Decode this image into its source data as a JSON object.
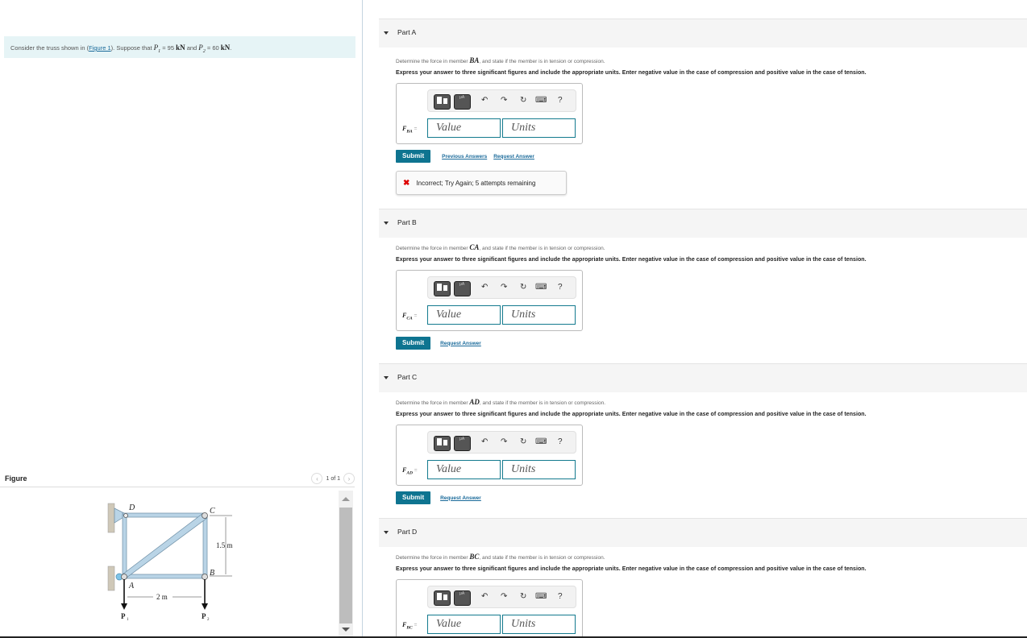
{
  "intro": {
    "prefix": "Consider the truss shown in (",
    "figure_link": "Figure 1",
    "mid": "). Suppose that ",
    "p1_sym": "P",
    "p1_sub": "1",
    "p1_eq": " = 95 ",
    "p1_unit": "kN",
    "and": " and ",
    "p2_sym": "P",
    "p2_sub": "2",
    "p2_eq": " = 60 ",
    "p2_unit": "kN",
    "end": "."
  },
  "figure": {
    "title": "Figure",
    "pager_text": "1 of 1",
    "labels": {
      "D": "D",
      "C": "C",
      "A": "A",
      "B": "B",
      "height": "1.5 m",
      "width": "2 m",
      "P1": "P",
      "P1_sub": "1",
      "P2": "P",
      "P2_sub": "2"
    },
    "colors": {
      "member": "#b9d4e6",
      "member_edge": "#6c8da4",
      "support": "#cfc8b8"
    }
  },
  "toolbar": {
    "templates_label": "",
    "symbols_label": "μA",
    "undo": "↶",
    "redo": "↷",
    "reset": "↻",
    "keyboard": "⌨",
    "help": "?"
  },
  "common": {
    "q1_prefix": "Determine the force in member ",
    "q1_suffix": ", and state if the member is in tension or compression.",
    "q2": "Express your answer to three significant figures and include the appropriate units. Enter negative value in the case of compression and positive value in the case of tension.",
    "value_placeholder": "Value",
    "units_placeholder": "Units",
    "submit": "Submit",
    "previous_answers": "Previous Answers",
    "request_answer": "Request Answer",
    "equals": " ="
  },
  "parts": [
    {
      "label": "Part A",
      "member": "BA",
      "var": "F",
      "var_sub": "BA",
      "feedback": "Incorrect; Try Again; 5 attempts remaining"
    },
    {
      "label": "Part B",
      "member": "CA",
      "var": "F",
      "var_sub": "CA"
    },
    {
      "label": "Part C",
      "member": "AD",
      "var": "F",
      "var_sub": "AD"
    },
    {
      "label": "Part D",
      "member": "BC",
      "var": "F",
      "var_sub": "BC"
    }
  ],
  "colors": {
    "accent": "#0e7490",
    "intro_bg": "#e6f4f6",
    "link": "#1a6a9a",
    "error": "#dd0000"
  }
}
